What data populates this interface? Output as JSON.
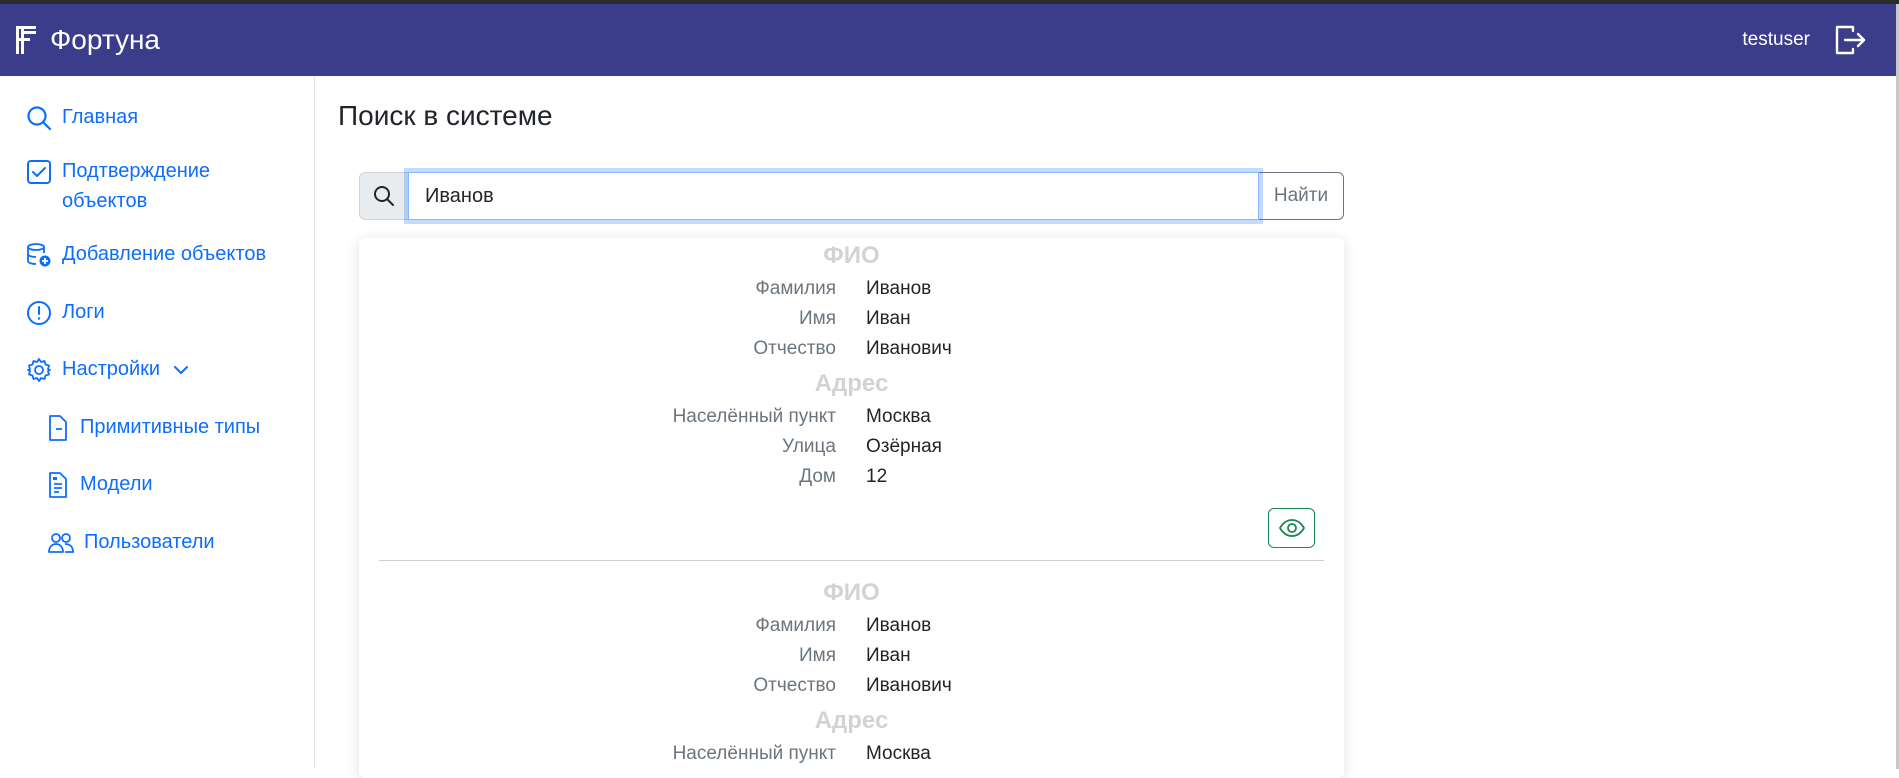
{
  "app": {
    "title": "Фортуна",
    "user": "testuser"
  },
  "sidebar": {
    "items": [
      {
        "label": "Главная",
        "icon": "search-icon"
      },
      {
        "label": "Подтверждение",
        "label2": "объектов",
        "icon": "check-square-icon"
      },
      {
        "label": "Добавление объектов",
        "icon": "database-add-icon"
      },
      {
        "label": "Логи",
        "icon": "exclamation-circle-icon"
      },
      {
        "label": "Настройки",
        "icon": "gear-icon"
      }
    ],
    "subitems": [
      {
        "label": "Примитивные типы",
        "icon": "file-minus-icon"
      },
      {
        "label": "Модели",
        "icon": "file-text-icon"
      },
      {
        "label": "Пользователи",
        "icon": "people-icon"
      }
    ]
  },
  "main": {
    "title": "Поиск в системе",
    "search": {
      "value": "Иванов",
      "button": "Найти"
    },
    "results": [
      {
        "section1": "ФИО",
        "fields1": [
          {
            "label": "Фамилия",
            "value": "Иванов"
          },
          {
            "label": "Имя",
            "value": "Иван"
          },
          {
            "label": "Отчество",
            "value": "Иванович"
          }
        ],
        "section2": "Адрес",
        "fields2": [
          {
            "label": "Населённый пункт",
            "value": "Москва"
          },
          {
            "label": "Улица",
            "value": "Озёрная"
          },
          {
            "label": "Дом",
            "value": "12"
          }
        ]
      },
      {
        "section1": "ФИО",
        "fields1": [
          {
            "label": "Фамилия",
            "value": "Иванов"
          },
          {
            "label": "Имя",
            "value": "Иван"
          },
          {
            "label": "Отчество",
            "value": "Иванович"
          }
        ],
        "section2": "Адрес",
        "fields2": [
          {
            "label": "Населённый пункт",
            "value": "Москва"
          }
        ]
      }
    ]
  },
  "colors": {
    "navbar": "#3c3d8a",
    "link": "#0d6efd",
    "success": "#198754",
    "section": "#d3d3d3"
  }
}
